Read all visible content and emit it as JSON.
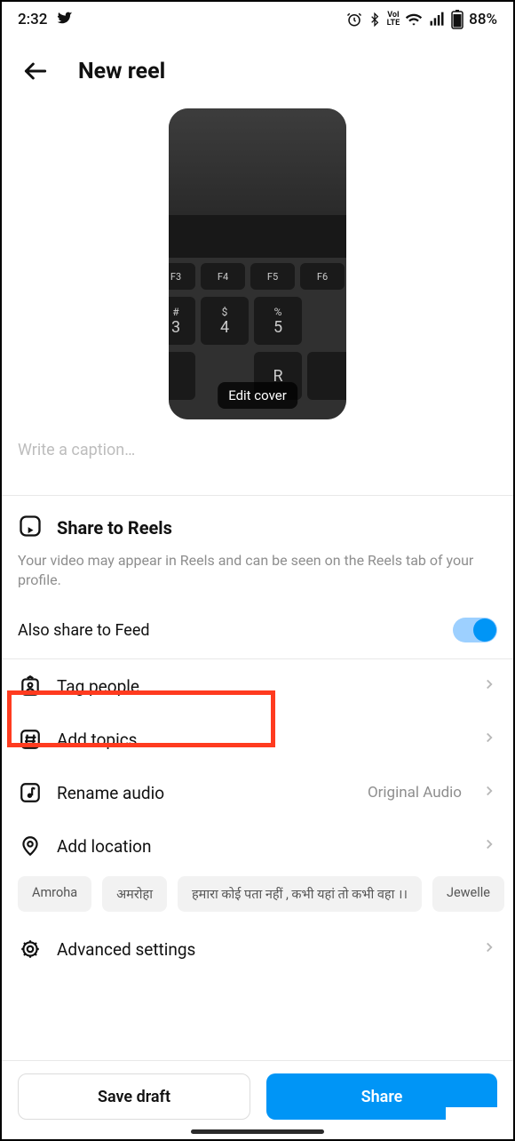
{
  "status": {
    "time": "2:32",
    "battery": "88%",
    "lte_top": "VoI",
    "lte_bottom": "LTE"
  },
  "header": {
    "title": "New reel"
  },
  "cover": {
    "edit_label": "Edit cover"
  },
  "caption": {
    "placeholder": "Write a caption…"
  },
  "reels": {
    "title": "Share to Reels",
    "desc": "Your video may appear in Reels and can be seen on the Reels tab of your profile."
  },
  "feed": {
    "label": "Also share to Feed"
  },
  "options": {
    "tag_people": "Tag people",
    "add_topics": "Add topics",
    "rename_audio": "Rename audio",
    "rename_audio_meta": "Original Audio",
    "add_location": "Add location",
    "advanced": "Advanced settings"
  },
  "chips": [
    "Amroha",
    "अमरोहा",
    "हमारा कोई पता नहीं , कभी यहां तो कभी वहा ।।",
    "Jewelle"
  ],
  "buttons": {
    "save_draft": "Save draft",
    "share": "Share"
  }
}
